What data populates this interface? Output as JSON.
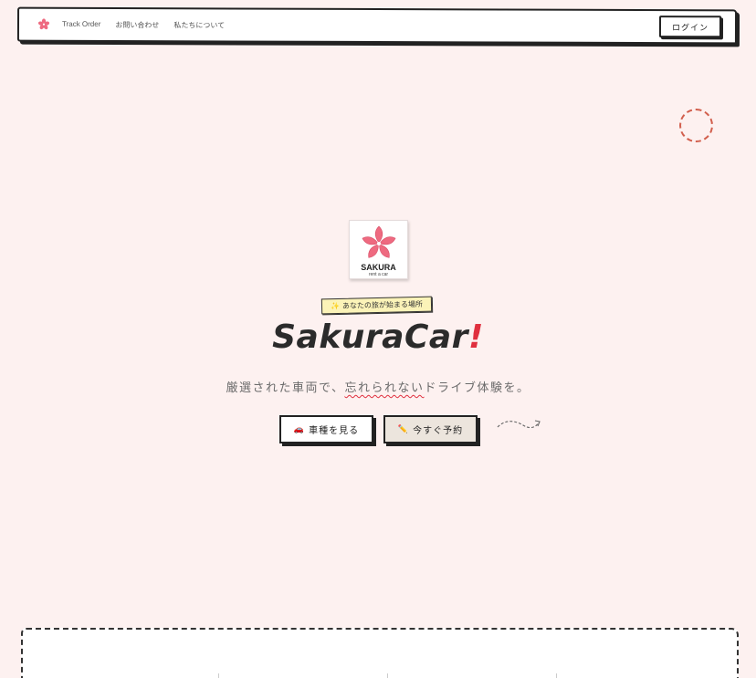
{
  "navbar": {
    "links": [
      "Track Order",
      "お問い合わせ",
      "私たちについて"
    ],
    "login_label": "ログイン"
  },
  "hero": {
    "logo_word": "SAKURA",
    "logo_sub": "rent a car",
    "tagline": "あなたの旅が始まる場所",
    "title": "SakuraCar",
    "title_mark": "!",
    "subtitle_before": "厳選された車両で、",
    "subtitle_emph": "忘れられない",
    "subtitle_after": "ドライブ体験を。",
    "buttons": {
      "cars_label": "車種を見る",
      "book_label": "今すぐ予約"
    }
  },
  "icons": {
    "logo": "sakura-flower-icon",
    "tagline": "sparkle-icon",
    "cars": "car-icon",
    "book": "pencil-icon"
  },
  "colors": {
    "background": "#fdf1f0",
    "accent": "#e0303f",
    "sakura": "#ee6a80",
    "badge": "#fbf3b8",
    "deco_circle": "#d2604e"
  }
}
